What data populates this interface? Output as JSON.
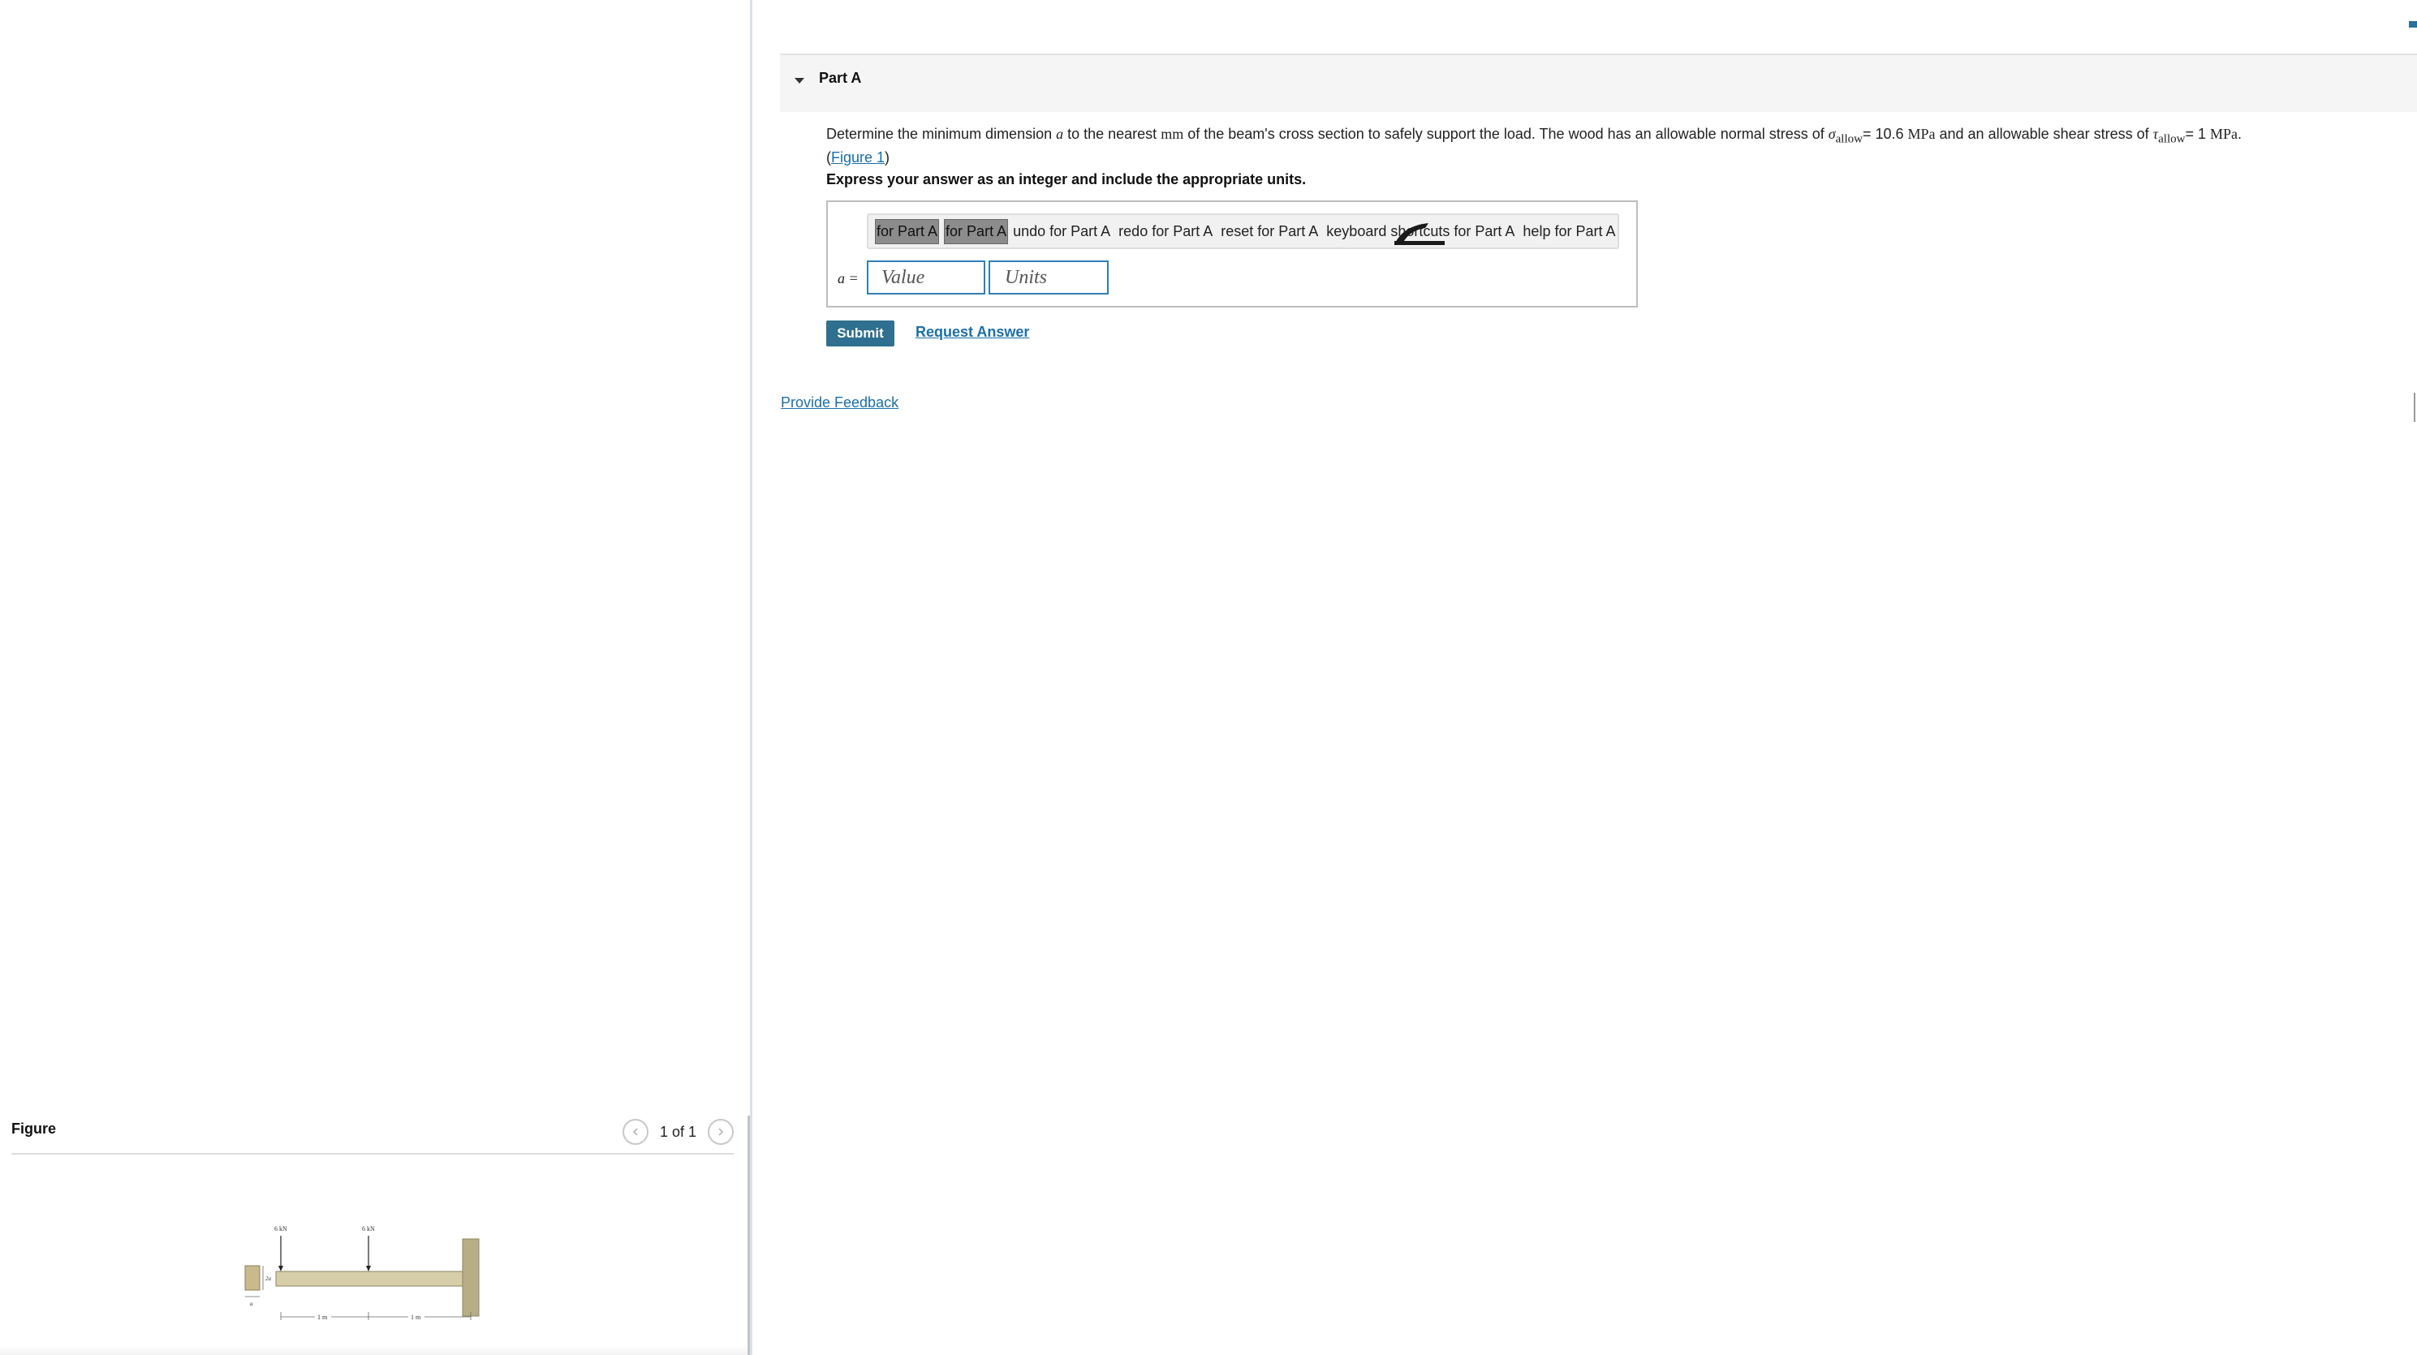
{
  "figure_panel": {
    "title": "Figure",
    "pager_text": "1 of 1",
    "prev_icon": "chevron-left-icon",
    "next_icon": "chevron-right-icon",
    "diagram_labels": {
      "load_1": "6 kN",
      "load_2": "6 kN",
      "height_label": "2a",
      "width_label": "a",
      "span_1": "1 m",
      "span_2": "1 m"
    }
  },
  "part": {
    "title": "Part A",
    "caret_icon": "caret-down-icon",
    "problem": {
      "t1": "Determine the minimum dimension ",
      "var_a": "a",
      "t2": " to the nearest ",
      "unit_mm": "mm",
      "t3": " of the beam's cross section to safely support the load. The wood has an allowable normal stress of ",
      "sigma_sym": "σ",
      "sigma_sub": "allow",
      "t4": "= 10.6 ",
      "unit_mpa_1": "MPa",
      "t5": " and an allowable shear stress of ",
      "tau_sym": "τ",
      "tau_sub": "allow",
      "t6": "= 1 ",
      "unit_mpa_2": "MPa",
      "t7": ".",
      "figure_open": "(",
      "figure_link": "Figure 1",
      "figure_close": ")"
    },
    "instruction": "Express your answer as an integer and include the appropriate units.",
    "toolbar": {
      "btn1": "for Part A",
      "btn2": "for Part A",
      "undo": "undo for Part A",
      "redo": "redo for Part A",
      "reset": "reset for Part A",
      "keyboard": "keyboard shortcuts for Part A",
      "help": "help for Part A"
    },
    "answer": {
      "label": "a =",
      "value_placeholder": "Value",
      "units_placeholder": "Units"
    },
    "submit_label": "Submit",
    "request_label": "Request Answer"
  },
  "feedback_label": "Provide Feedback",
  "colors": {
    "accent": "#2f6f8f",
    "link": "#1c6faa",
    "input_border": "#2f7fb8"
  }
}
